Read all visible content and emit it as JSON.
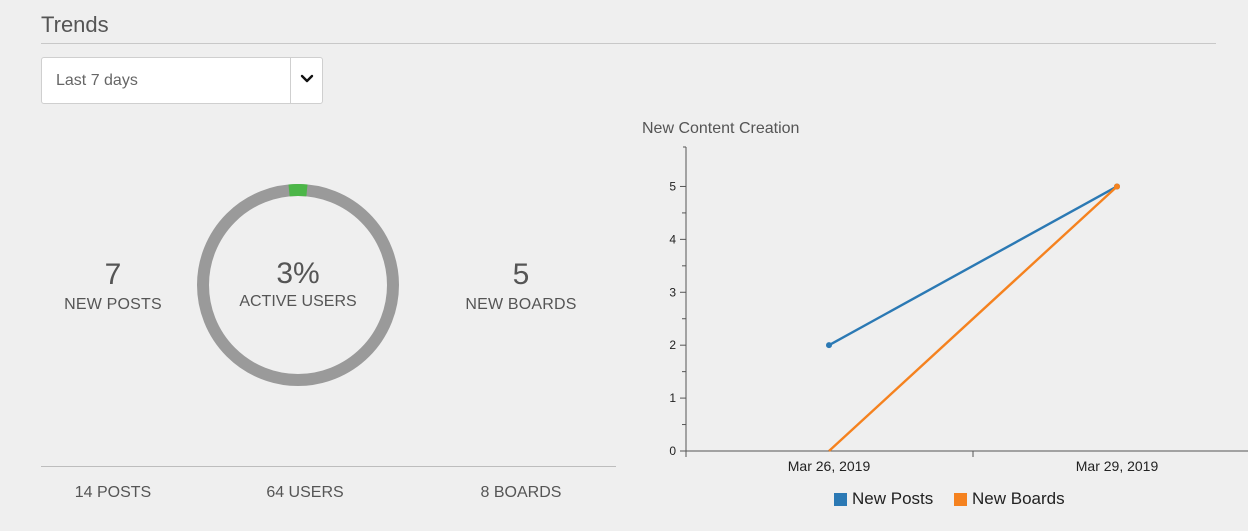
{
  "page": {
    "title": "Trends"
  },
  "filter": {
    "selected": "Last 7 days"
  },
  "stats": {
    "posts": {
      "value": "7",
      "label": "NEW POSTS"
    },
    "active_users": {
      "value": "3%",
      "label": "ACTIVE USERS",
      "percent": 3
    },
    "boards": {
      "value": "5",
      "label": "NEW BOARDS"
    }
  },
  "totals": {
    "posts": "14 POSTS",
    "users": "64 USERS",
    "boards": "8 BOARDS"
  },
  "colors": {
    "donut_track": "#9a9a9a",
    "donut_fill": "#4cb648",
    "posts": "#2b79b4",
    "boards": "#f5821f"
  },
  "chart_data": {
    "type": "line",
    "title": "New Content Creation",
    "x": [
      "Mar 26, 2019",
      "Mar 29, 2019"
    ],
    "ylim": [
      0,
      5.5
    ],
    "yticks": [
      "0",
      "1",
      "2",
      "3",
      "4",
      "5"
    ],
    "series": [
      {
        "name": "New Posts",
        "values": [
          2,
          5
        ],
        "color": "#2b79b4"
      },
      {
        "name": "New Boards",
        "values": [
          0,
          5
        ],
        "color": "#f5821f"
      }
    ],
    "legend_position": "bottom",
    "grid": false
  }
}
